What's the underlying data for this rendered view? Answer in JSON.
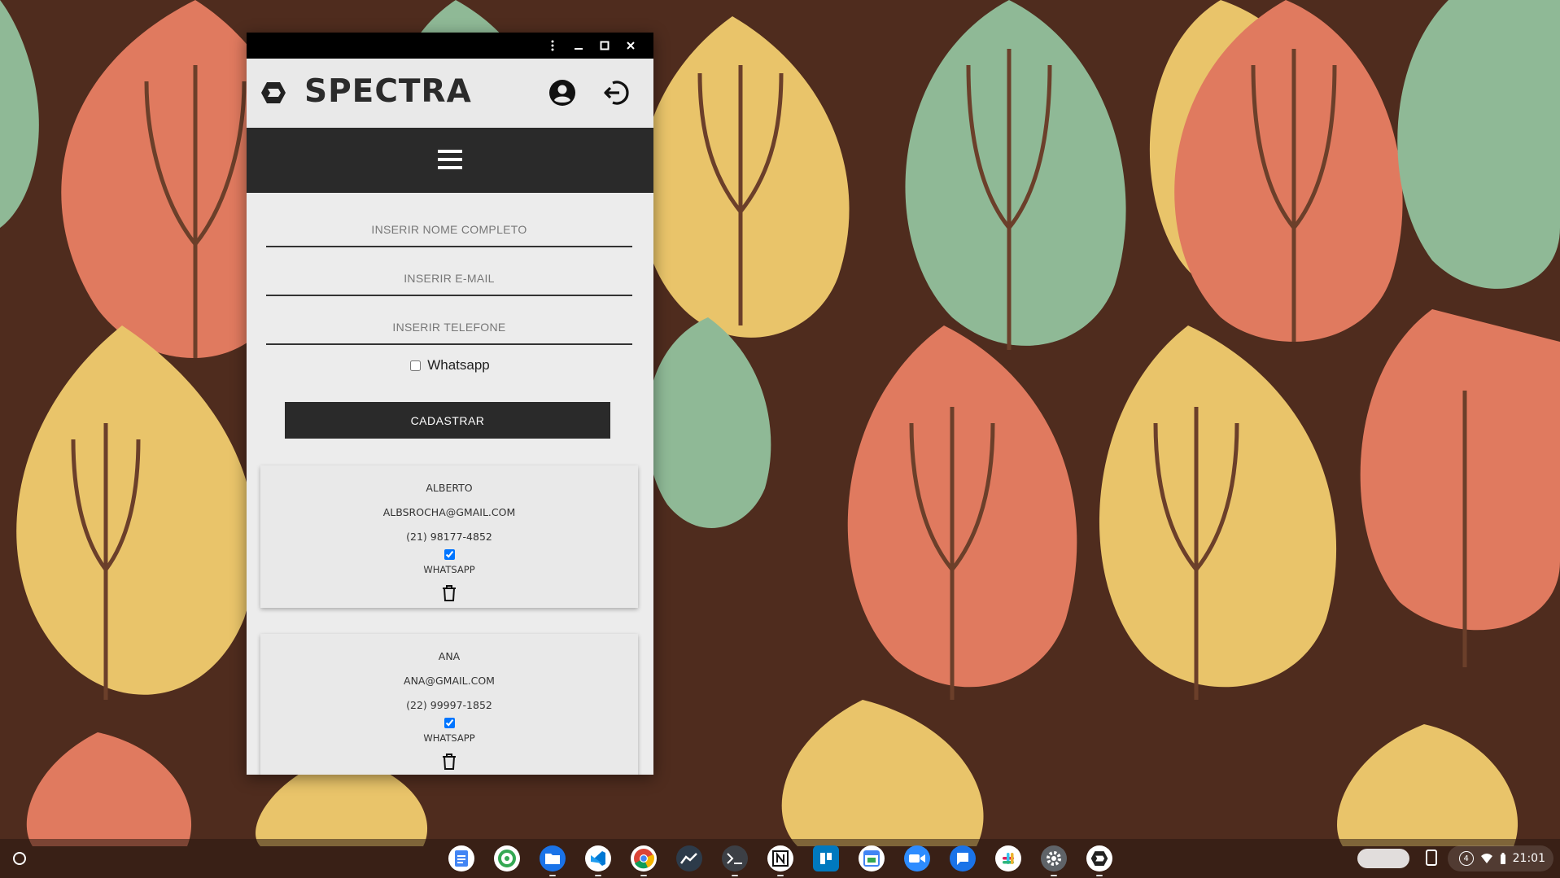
{
  "window": {
    "menu_icon": "more-vert-icon",
    "minimize_icon": "minimize-icon",
    "maximize_icon": "maximize-icon",
    "close_icon": "close-icon"
  },
  "header": {
    "brand": "SPECTRA",
    "logo_icon": "spectra-logo-icon",
    "account_icon": "account-circle-icon",
    "logout_icon": "logout-icon"
  },
  "nav": {
    "menu_icon": "hamburger-menu-icon"
  },
  "form": {
    "name_placeholder": "INSERIR NOME COMPLETO",
    "email_placeholder": "INSERIR E-MAIL",
    "phone_placeholder": "INSERIR TELEFONE",
    "whatsapp_label": "Whatsapp",
    "whatsapp_checked": false,
    "submit_label": "CADASTRAR"
  },
  "contacts": [
    {
      "name": "ALBERTO",
      "email": "ALBSROCHA@GMAIL.COM",
      "phone": "(21) 98177-4852",
      "whatsapp_checked": true,
      "whatsapp_label": "WHATSAPP"
    },
    {
      "name": "ANA",
      "email": "ANA@GMAIL.COM",
      "phone": "(22) 99997-1852",
      "whatsapp_checked": true,
      "whatsapp_label": "WHATSAPP"
    }
  ],
  "taskbar": {
    "apps": [
      "google-docs",
      "chrome-remote",
      "files",
      "vscode",
      "chrome",
      "activity-monitor",
      "terminal",
      "notion",
      "trello",
      "google-calendar",
      "zoom",
      "messages",
      "slack",
      "settings",
      "spectra"
    ],
    "tray": {
      "notification_count": "4",
      "time": "21:01"
    }
  },
  "colors": {
    "wallpaper_bg": "#4f2c1e",
    "leaf_orange": "#e07a5f",
    "leaf_yellow": "#e9c46a",
    "leaf_green": "#8fb996",
    "window_bg": "#ececec",
    "navbar": "#2a2a2a",
    "accent_check": "#1a73e8"
  }
}
